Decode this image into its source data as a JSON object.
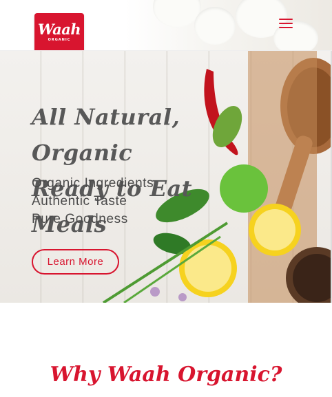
{
  "header": {
    "logo": {
      "word": "Waah",
      "sub": "ORGANIC",
      "color": "#d8152f"
    },
    "menu_icon": "hamburger-menu-icon"
  },
  "hero": {
    "headline_line1": "All Natural, Organic",
    "headline_line2": "Ready to Eat Meals",
    "features": [
      "Organic Ingredients",
      "Authentic Taste",
      "Pure Goodness"
    ],
    "cta_label": "Learn More"
  },
  "section": {
    "title": "Why Waah Organic?"
  },
  "colors": {
    "accent": "#d8152f",
    "text": "#585858",
    "background": "#ffffff"
  }
}
